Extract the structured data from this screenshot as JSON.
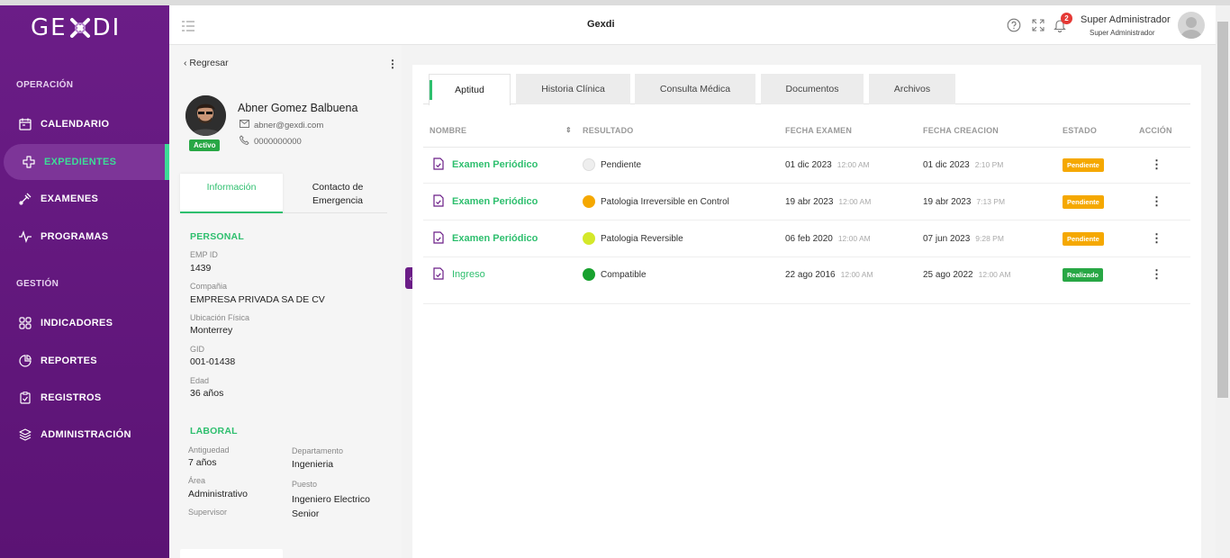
{
  "sidebar": {
    "logo_left": "GE",
    "logo_right": "DI",
    "section_operacion": "OPERACIÓN",
    "section_gestion": "GESTIÓN",
    "items": [
      {
        "label": "CALENDARIO",
        "icon": "calendar-icon"
      },
      {
        "label": "EXPEDIENTES",
        "icon": "medical-icon",
        "active": true
      },
      {
        "label": "EXAMENES",
        "icon": "stethoscope-icon"
      },
      {
        "label": "PROGRAMAS",
        "icon": "pulse-icon"
      },
      {
        "label": "INDICADORES",
        "icon": "grid-icon"
      },
      {
        "label": "REPORTES",
        "icon": "pie-chart-icon"
      },
      {
        "label": "REGISTROS",
        "icon": "clipboard-icon"
      },
      {
        "label": "ADMINISTRACIÓN",
        "icon": "layers-icon"
      }
    ],
    "accent": "#3ddc97",
    "background": "#6b1d87"
  },
  "header": {
    "title": "Gexdi",
    "notification_count": "2",
    "user_name": "Super Administrador",
    "user_role": "Super Administrador"
  },
  "profile": {
    "back_label": "Regresar",
    "name": "Abner Gomez Balbuena",
    "email": "abner@gexdi.com",
    "phone": "0000000000",
    "status_badge": "Activo",
    "tabs": [
      "Información",
      "Contacto de Emergencia"
    ],
    "personal": {
      "title": "PERSONAL",
      "fields": [
        {
          "label": "EMP ID",
          "value": "1439"
        },
        {
          "label": "Compañia",
          "value": "EMPRESA PRIVADA SA DE CV"
        },
        {
          "label": "Ubicación Física",
          "value": "Monterrey"
        },
        {
          "label": "GID",
          "value": "001-01438"
        },
        {
          "label": "Edad",
          "value": "36 años"
        }
      ]
    },
    "laboral": {
      "title": "LABORAL",
      "antiguedad_label": "Antiguedad",
      "antiguedad_value": "7 años",
      "area_label": "Área",
      "area_value": "Administrativo",
      "supervisor_label": "Supervisor",
      "departamento_label": "Departamento",
      "departamento_value": "Ingenieria",
      "puesto_label": "Puesto",
      "puesto_value": "Ingeniero Electrico Senior"
    }
  },
  "main": {
    "tabs": [
      "Aptitud",
      "Historia Clínica",
      "Consulta Médica",
      "Documentos",
      "Archivos"
    ],
    "columns": [
      "NOMBRE",
      "RESULTADO",
      "FECHA EXAMEN",
      "FECHA CREACION",
      "ESTADO",
      "ACCIÓN"
    ],
    "rows": [
      {
        "name": "Examen Periódico",
        "result": "Pendiente",
        "result_color": "#eeeeee",
        "exam_date": "01 dic 2023",
        "exam_time": "12:00 AM",
        "created_date": "01 dic 2023",
        "created_time": "2:10 PM",
        "status": "Pendiente",
        "status_color": "#f5a800"
      },
      {
        "name": "Examen Periódico",
        "result": "Patologia Irreversible en Control",
        "result_color": "#f5a800",
        "exam_date": "19 abr 2023",
        "exam_time": "12:00 AM",
        "created_date": "19 abr 2023",
        "created_time": "7:13 PM",
        "status": "Pendiente",
        "status_color": "#f5a800"
      },
      {
        "name": "Examen Periódico",
        "result": "Patologia Reversible",
        "result_color": "#d4e82a",
        "exam_date": "06 feb 2020",
        "exam_time": "12:00 AM",
        "created_date": "07 jun 2023",
        "created_time": "9:28 PM",
        "status": "Pendiente",
        "status_color": "#f5a800"
      },
      {
        "name": "Ingreso",
        "result": "Compatible",
        "result_color": "#18a12e",
        "exam_date": "22 ago 2016",
        "exam_time": "12:00 AM",
        "created_date": "25 ago 2022",
        "created_time": "12:00 AM",
        "status": "Realizado",
        "status_color": "#28a745"
      }
    ]
  }
}
